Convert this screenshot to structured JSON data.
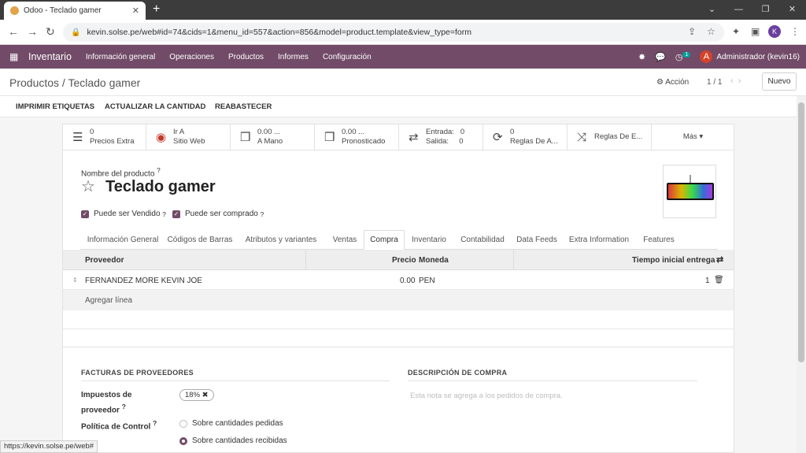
{
  "browser": {
    "tab_title": "Odoo - Teclado gamer",
    "new_tab": "+",
    "url": "kevin.solse.pe/web#id=74&cids=1&menu_id=557&action=856&model=product.template&view_type=form",
    "profile_initial": "K",
    "status_url": "https://kevin.solse.pe/web#"
  },
  "topnav": {
    "app_name": "Inventario",
    "menus": [
      "Información general",
      "Operaciones",
      "Productos",
      "Informes",
      "Configuración"
    ],
    "activity_count": "1",
    "user_initial": "A",
    "user_name": "Administrador (kevin16)"
  },
  "control_panel": {
    "breadcrumb": "Productos / Teclado gamer",
    "action_label": "Acción",
    "pager": "1 / 1",
    "new_button": "Nuevo"
  },
  "status_actions": [
    "IMPRIMIR ETIQUETAS",
    "ACTUALIZAR LA CANTIDAD",
    "REABASTECER"
  ],
  "smart_buttons": [
    {
      "icon": "list-icon",
      "line1": "0",
      "line2": "Precios Extra"
    },
    {
      "icon": "globe-icon",
      "line1": "Ir A",
      "line2": "Sitio Web"
    },
    {
      "icon": "cubes-icon",
      "line1": "0.00 ...",
      "line2": "A Mano"
    },
    {
      "icon": "cubes-icon",
      "line1": "0.00 ...",
      "line2": "Pronosticado"
    },
    {
      "icon": "exchange-icon",
      "line1": "Entrada:   0",
      "line2": "Salida:     0"
    },
    {
      "icon": "refresh-icon",
      "line1": "0",
      "line2": "Reglas De A..."
    },
    {
      "icon": "shuffle-icon",
      "line1": "Reglas De E...",
      "line2": ""
    },
    {
      "icon": "",
      "line1": "Más ▾",
      "line2": ""
    }
  ],
  "form": {
    "name_label": "Nombre del producto",
    "help_mark": "?",
    "product_name": "Teclado gamer",
    "can_be_sold": "Puede ser Vendido",
    "can_be_purchased": "Puede ser comprado"
  },
  "tabs": [
    "Información General",
    "Códigos de Barras",
    "Atributos y variantes",
    "Ventas",
    "Compra",
    "Inventario",
    "Contabilidad",
    "Data Feeds",
    "Extra Information",
    "Features"
  ],
  "active_tab": "Compra",
  "vendors_table": {
    "headers": {
      "vendor": "Proveedor",
      "price": "Precio",
      "currency": "Moneda",
      "lead_time": "Tiempo inicial entrega"
    },
    "rows": [
      {
        "vendor": "FERNANDEZ MORE KEVIN JOE",
        "price": "0.00",
        "currency": "PEN",
        "lead_time": "1"
      }
    ],
    "add_line": "Agregar línea"
  },
  "vendor_bills": {
    "section_title": "FACTURAS DE PROVEEDORES",
    "tax_label_line1": "Impuestos de",
    "tax_label_line2": "proveedor",
    "tax_value": "18%",
    "control_policy_label": "Política de Control",
    "option_ordered": "Sobre cantidades pedidas",
    "option_received": "Sobre cantidades recibidas",
    "selected_option": "Sobre cantidades recibidas"
  },
  "purchase_description": {
    "section_title": "DESCRIPCIÓN DE COMPRA",
    "placeholder": "Esta nota se agrega a los pedidos de compra."
  },
  "colors": {
    "brand": "#714b67",
    "chrome_dark": "#3c3c3c"
  }
}
